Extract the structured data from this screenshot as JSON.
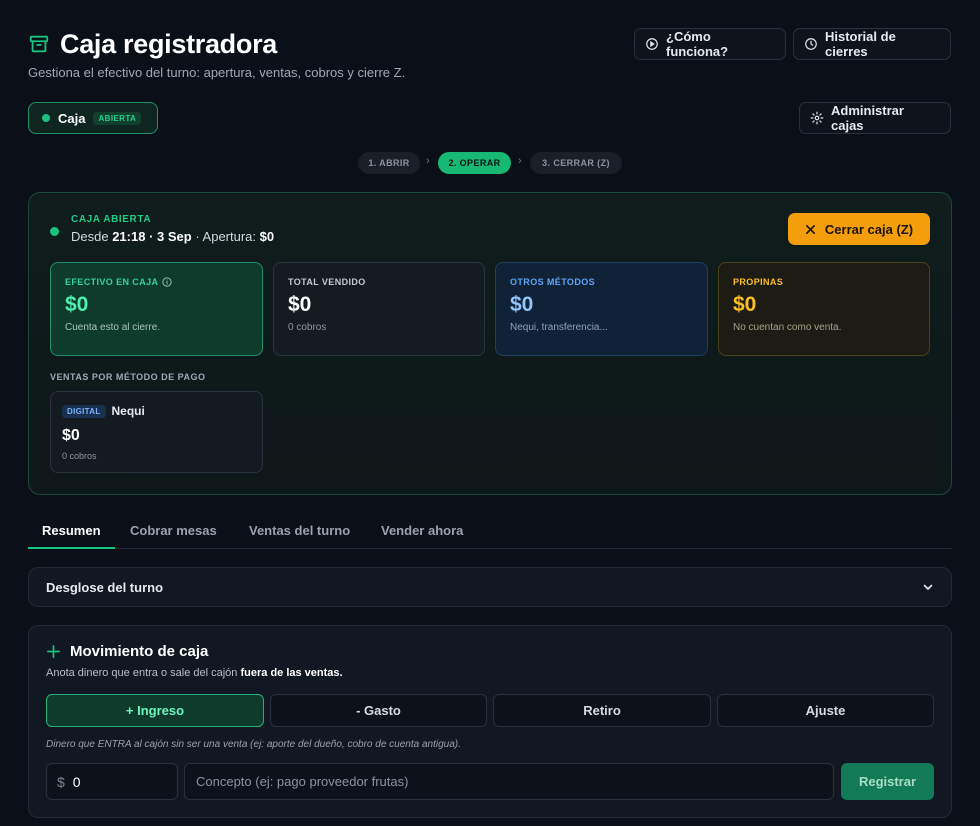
{
  "header": {
    "title": "Caja registradora",
    "subtitle": "Gestiona el efectivo del turno: apertura, ventas, cobros y cierre Z.",
    "how_label": "¿Cómo funciona?",
    "history_label": "Historial de cierres"
  },
  "caja_pill": {
    "label": "Caja",
    "badge": "ABIERTA"
  },
  "manage_label": "Administrar cajas",
  "steps": [
    {
      "label": "1. ABRIR",
      "active": false
    },
    {
      "label": "2. OPERAR",
      "active": true
    },
    {
      "label": "3. CERRAR (Z)",
      "active": false
    }
  ],
  "status": {
    "title": "CAJA ABIERTA",
    "prefix": "Desde",
    "since": "21:18 · 3 Sep",
    "opening_label": "· Apertura:",
    "opening_value": "$0",
    "close_label": "Cerrar caja (Z)"
  },
  "cards": {
    "cash": {
      "label": "EFECTIVO EN CAJA",
      "value": "$0",
      "note": "Cuenta esto al cierre."
    },
    "sold": {
      "label": "TOTAL VENDIDO",
      "value": "$0",
      "note": "0 cobros"
    },
    "other": {
      "label": "OTROS MÉTODOS",
      "value": "$0",
      "note": "Nequi, transferencia..."
    },
    "tips": {
      "label": "PROPINAS",
      "value": "$0",
      "note": "No cuentan como venta."
    }
  },
  "methods": {
    "title": "VENTAS POR MÉTODO DE PAGO",
    "items": [
      {
        "badge": "DIGITAL",
        "name": "Nequi",
        "value": "$0",
        "note": "0 cobros"
      }
    ]
  },
  "tabs": [
    "Resumen",
    "Cobrar mesas",
    "Ventas del turno",
    "Vender ahora"
  ],
  "accordion": {
    "title": "Desglose del turno"
  },
  "movement": {
    "title": "Movimiento de caja",
    "desc_prefix": "Anota dinero que entra o sale del cajón ",
    "desc_bold": "fuera de las ventas.",
    "types": [
      "+ Ingreso",
      "- Gasto",
      "Retiro",
      "Ajuste"
    ],
    "selected": "+ Ingreso",
    "hint": "Dinero que ENTRA al cajón sin ser una venta (ej: aporte del dueño, cobro de cuenta antigua).",
    "amount_prefix": "$",
    "amount_value": "0",
    "concept_placeholder": "Concepto (ej: pago proveedor frutas)",
    "register_label": "Registrar"
  },
  "colors": {
    "accent": "#19c37d",
    "warning": "#f59e0b",
    "info": "#60a5fa",
    "background": "#0b0f17"
  }
}
